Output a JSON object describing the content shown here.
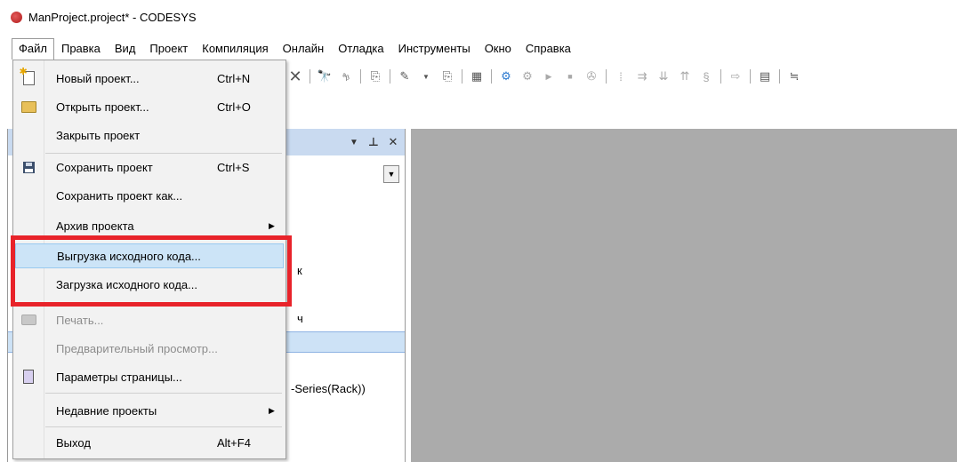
{
  "window": {
    "title": "ManProject.project* - CODESYS"
  },
  "menubar": {
    "items": [
      "Файл",
      "Правка",
      "Вид",
      "Проект",
      "Компиляция",
      "Онлайн",
      "Отладка",
      "Инструменты",
      "Окно",
      "Справка"
    ]
  },
  "file_menu": {
    "items": [
      {
        "label": "Новый проект...",
        "shortcut": "Ctrl+N",
        "icon": "new-project-icon",
        "enabled": true
      },
      {
        "label": "Открыть проект...",
        "shortcut": "Ctrl+O",
        "icon": "open-folder-icon",
        "enabled": true
      },
      {
        "label": "Закрыть проект",
        "shortcut": "",
        "icon": "",
        "enabled": true
      },
      {
        "label": "Сохранить проект",
        "shortcut": "Ctrl+S",
        "icon": "save-icon",
        "enabled": true
      },
      {
        "label": "Сохранить проект как...",
        "shortcut": "",
        "icon": "",
        "enabled": true
      },
      {
        "label": "Архив проекта",
        "shortcut": "",
        "icon": "",
        "enabled": true,
        "submenu": true
      },
      {
        "label": "Выгрузка исходного кода...",
        "shortcut": "",
        "icon": "",
        "enabled": true,
        "highlighted": true
      },
      {
        "label": "Загрузка исходного кода...",
        "shortcut": "",
        "icon": "",
        "enabled": true
      },
      {
        "label": "Печать...",
        "shortcut": "",
        "icon": "print-icon",
        "enabled": false
      },
      {
        "label": "Предварительный просмотр...",
        "shortcut": "",
        "icon": "",
        "enabled": false
      },
      {
        "label": "Параметры страницы...",
        "shortcut": "",
        "icon": "page-setup-icon",
        "enabled": true
      },
      {
        "label": "Недавние проекты",
        "shortcut": "",
        "icon": "",
        "enabled": true,
        "submenu": true
      },
      {
        "label": "Выход",
        "shortcut": "Alt+F4",
        "icon": "",
        "enabled": true
      }
    ]
  },
  "tree_fragments": {
    "row1": "к",
    "row2": "ч",
    "row3": "-Series(Rack))"
  },
  "colors": {
    "accent": "#e8232a",
    "menu_bg": "#f2f2f2",
    "highlight": "#cce4f7",
    "panel_header": "#c9daf0",
    "editor_bg": "#ababab"
  }
}
